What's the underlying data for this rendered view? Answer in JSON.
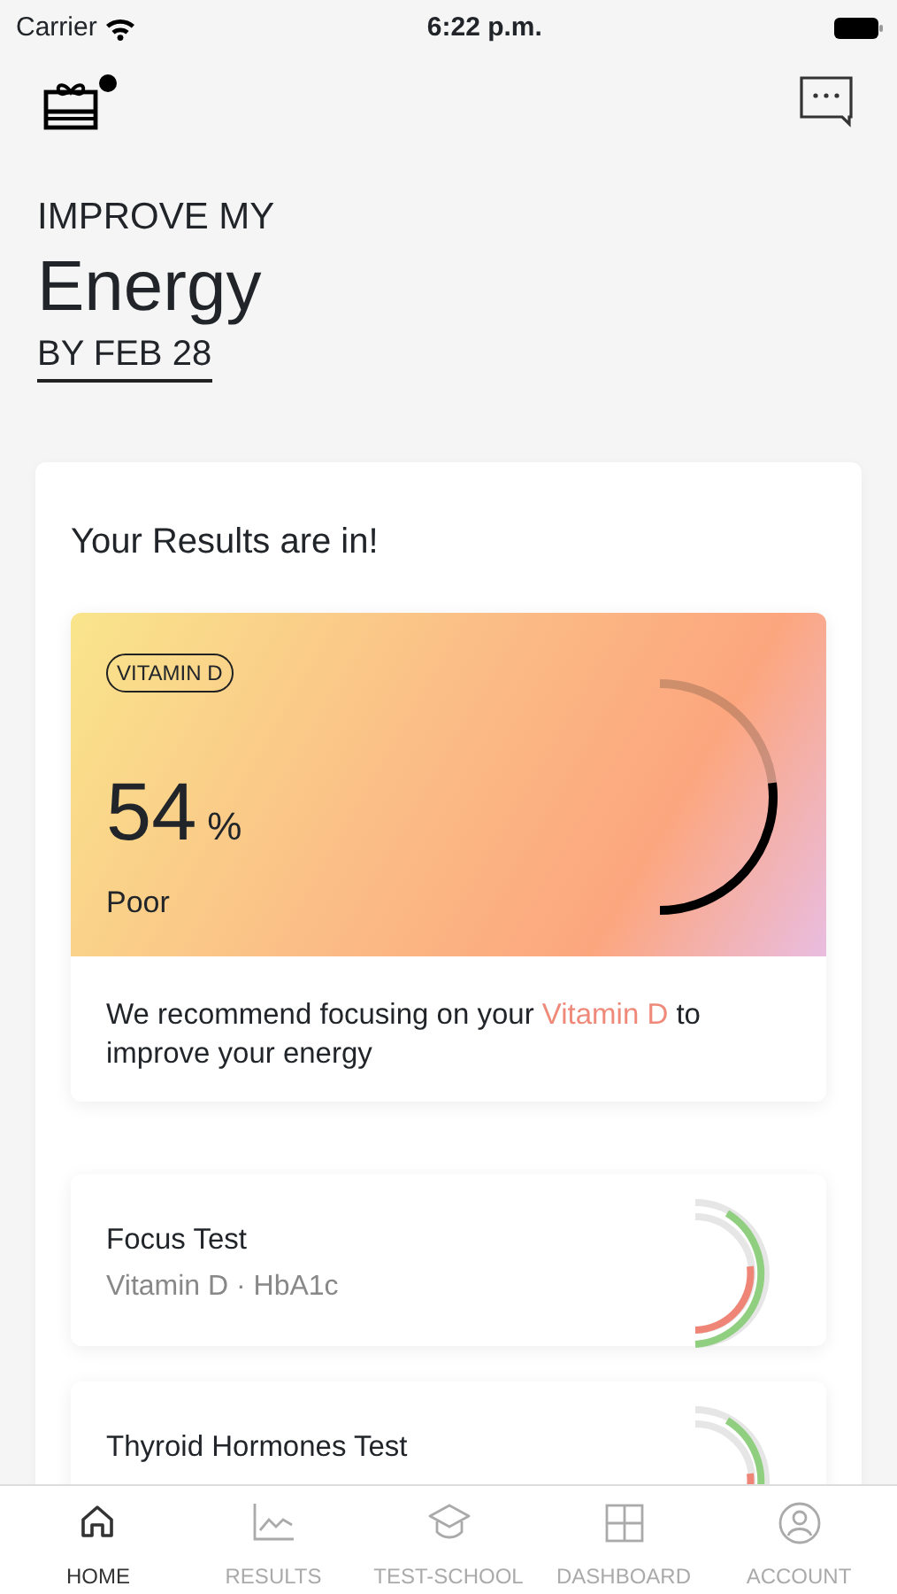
{
  "status_bar": {
    "carrier": "Carrier",
    "time": "6:22 p.m."
  },
  "header": {
    "gift_badge": true
  },
  "goal": {
    "kicker": "IMPROVE MY",
    "title": "Energy",
    "deadline": "BY FEB 28"
  },
  "results": {
    "title": "Your Results are in!",
    "highlight_card": {
      "tag": "VITAMIN D",
      "score": "54",
      "unit": "%",
      "rating": "Poor",
      "level": 0.54,
      "recommendation": {
        "before": "We recommend focusing on your ",
        "highlight": "Vitamin D",
        "after": " to improve your energy"
      }
    },
    "tests": [
      {
        "title": "Focus Test",
        "subtitle": "Vitamin D · HbA1c"
      },
      {
        "title": "Thyroid Hormones Test"
      }
    ]
  },
  "tab_bar": [
    {
      "label": "HOME",
      "selected": true
    },
    {
      "label": "RESULTS",
      "selected": false
    },
    {
      "label": "TEST-SCHOOL",
      "selected": false
    },
    {
      "label": "DASHBOARD",
      "selected": false
    },
    {
      "label": "ACCOUNT",
      "selected": false
    }
  ]
}
